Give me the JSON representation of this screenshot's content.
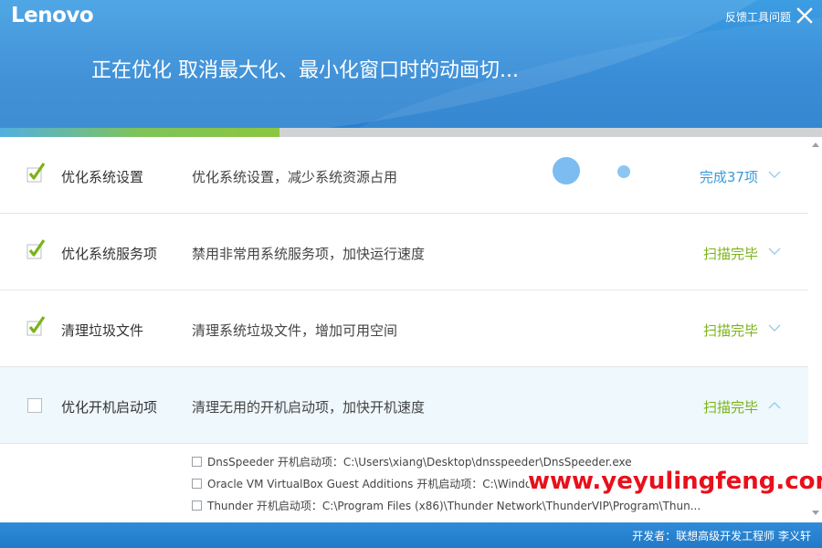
{
  "header": {
    "logo": "Lenovo",
    "feedback": "反馈工具问题",
    "headline": "正在优化 取消最大化、最小化窗口时的动画切..."
  },
  "progress": {
    "value": 0.34,
    "fill_color": "#8cc63f",
    "track_color": "#cfd3d6"
  },
  "rows": [
    {
      "checked": true,
      "title": "优化系统设置",
      "description": "优化系统设置，减少系统资源占用",
      "status": "完成37项",
      "status_color": "#3a9bd9",
      "chevron": "chevron-down-icon"
    },
    {
      "checked": true,
      "title": "优化系统服务项",
      "description": "禁用非常用系统服务项，加快运行速度",
      "status": "扫描完毕",
      "status_color": "#7ab317",
      "chevron": "chevron-down-icon"
    },
    {
      "checked": true,
      "title": "清理垃圾文件",
      "description": "清理系统垃圾文件，增加可用空间",
      "status": "扫描完毕",
      "status_color": "#7ab317",
      "chevron": "chevron-down-icon"
    },
    {
      "checked": false,
      "title": "优化开机启动项",
      "description": "清理无用的开机启动项，加快开机速度",
      "status": "扫描完毕",
      "status_color": "#7ab317",
      "chevron": "chevron-up-icon"
    }
  ],
  "startup_items": [
    {
      "checked": false,
      "label": "DnsSpeeder 开机启动项：C:\\Users\\xiang\\Desktop\\dnsspeeder\\DnsSpeeder.exe"
    },
    {
      "checked": false,
      "label": "Oracle VM VirtualBox Guest Additions 开机启动项：C:\\Windo"
    },
    {
      "checked": false,
      "label": "Thunder 开机启动项：C:\\Program Files (x86)\\Thunder Network\\ThunderVIP\\Program\\Thun..."
    }
  ],
  "footer": {
    "developer": "开发者：联想高级开发工程师 李义轩"
  },
  "watermark": "www.yeyulingfeng.com",
  "colors": {
    "header": "#2d86d4",
    "footer": "#2279c7",
    "accent_green": "#7ab317",
    "accent_blue": "#3a9bd9",
    "watermark": "#e8101b"
  }
}
